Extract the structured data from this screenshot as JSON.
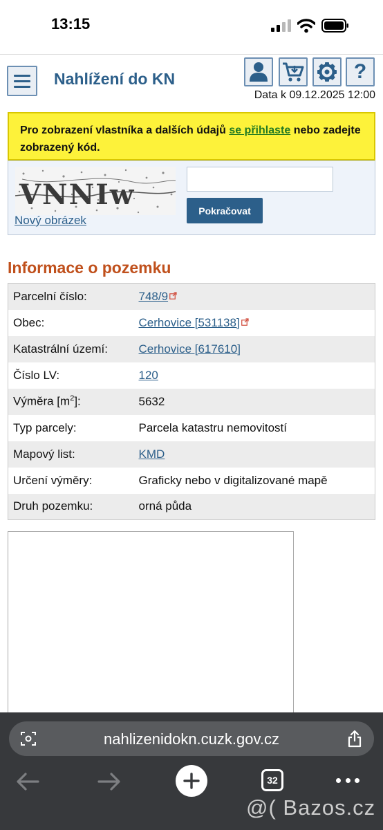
{
  "status_bar": {
    "time": "13:15"
  },
  "header": {
    "title": "Nahlížení do KN",
    "date_text": "Data k 09.12.2025 12:00",
    "icons": [
      "user-icon",
      "cart-icon",
      "gear-icon",
      "help-icon"
    ]
  },
  "notice": {
    "text_before": "Pro zobrazení vlastníka a dalších údajů ",
    "link_text": "se přihlaste",
    "text_after": " nebo zadejte zobrazený kód."
  },
  "captcha": {
    "new_image_link": "Nový obrázek",
    "input_value": "",
    "submit_label": "Pokračovat",
    "image_text": "VNNIw"
  },
  "section_title": "Informace o pozemku",
  "parcel_info": [
    {
      "label": "Parcelní číslo:",
      "value": "748/9",
      "link": true,
      "external": true
    },
    {
      "label": "Obec:",
      "value": "Cerhovice [531138]",
      "link": true,
      "external": true
    },
    {
      "label": "Katastrální území:",
      "value": "Cerhovice [617610]",
      "link": true,
      "external": false
    },
    {
      "label": "Číslo LV:",
      "value": "120",
      "link": true,
      "external": false
    },
    {
      "label_main": "Výměra [m",
      "label_sup": "2",
      "label_end": "]:",
      "value": "5632",
      "link": false,
      "external": false
    },
    {
      "label": "Typ parcely:",
      "value": "Parcela katastru nemovitostí",
      "link": false,
      "external": false
    },
    {
      "label": "Mapový list:",
      "value": "KMD",
      "link": true,
      "external": false
    },
    {
      "label": "Určení výměry:",
      "value": "Graficky nebo v digitalizované mapě",
      "link": false,
      "external": false
    },
    {
      "label": "Druh pozemku:",
      "value": "orná půda",
      "link": false,
      "external": false
    }
  ],
  "browser": {
    "url": "nahlizenidokn.cuzk.gov.cz",
    "tab_count": "32"
  },
  "watermark": "@( Bazos.cz",
  "colors": {
    "brand_blue": "#2c5f8a",
    "heading_orange": "#c0501c",
    "notice_yellow": "#fdf23a",
    "login_link_green": "#227a22"
  }
}
